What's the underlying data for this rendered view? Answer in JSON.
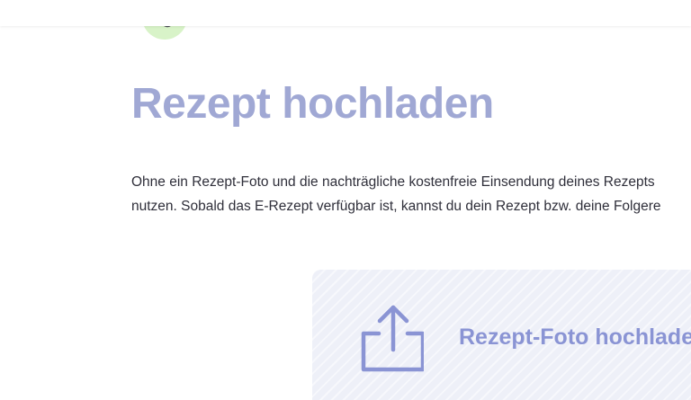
{
  "header": {
    "logo_icon": "brand-badge-icon"
  },
  "main": {
    "title": "Rezept hochladen",
    "intro_line_1": "Ohne ein Rezept-Foto und die nachträgliche kostenfreie Einsendung deines Rezepts",
    "intro_line_2": "nutzen. Sobald das E-Rezept verfügbar ist, kannst du dein Rezept bzw. deine Folgere"
  },
  "upload": {
    "label": "Rezept-Foto hochladen",
    "icon": "upload-icon"
  },
  "colors": {
    "title": "#a0a8d4",
    "accent": "#8a94d4",
    "badge": "#d8f3c8",
    "box_bg": "#eef0f8",
    "text": "#2f2f3a"
  }
}
